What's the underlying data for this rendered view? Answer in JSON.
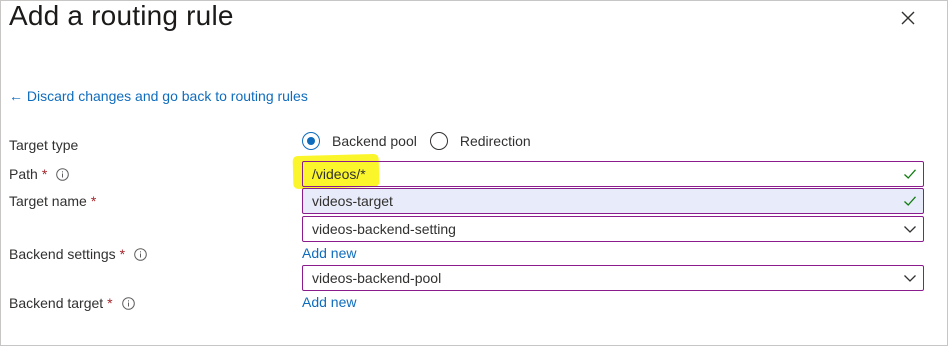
{
  "panel": {
    "title": "Add a routing rule",
    "back_link": "← Discard changes and go back to routing rules"
  },
  "form": {
    "target_type": {
      "label": "Target type",
      "options": [
        "Backend pool",
        "Redirection"
      ],
      "selected": "Backend pool"
    },
    "path": {
      "label": "Path",
      "required_mark": "*",
      "value": "/videos/*",
      "valid": true
    },
    "target_name": {
      "label": "Target name",
      "required_mark": "*",
      "value": "videos-target",
      "valid": true
    },
    "backend_settings": {
      "label": "Backend settings",
      "required_mark": "*",
      "value": "videos-backend-setting",
      "add_new": "Add new"
    },
    "backend_target": {
      "label": "Backend target",
      "required_mark": "*",
      "value": "videos-backend-pool",
      "add_new": "Add new"
    }
  },
  "colors": {
    "accent": "#0f6cbd",
    "required": "#a4262c",
    "field_border": "#8a1c8d",
    "valid_check": "#107c10",
    "highlight": "#fbf62c"
  },
  "icons": {
    "close": "close-icon",
    "info": "info-icon",
    "valid": "checkmark-icon",
    "dropdown": "chevron-down-icon"
  }
}
